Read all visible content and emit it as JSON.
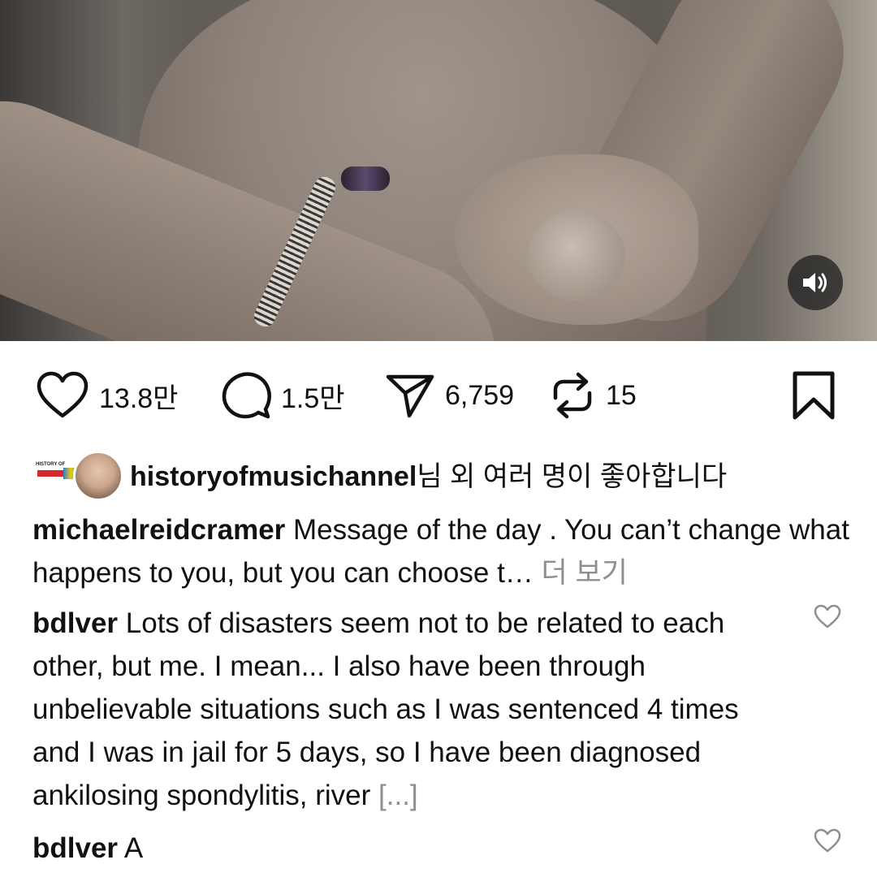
{
  "actions": {
    "likes_count": "13.8만",
    "comments_count": "1.5만",
    "shares_count": "6,759",
    "reposts_count": "15"
  },
  "liked_by": {
    "user": "historyofmusichannel",
    "suffix": "님 외 여러 명이 좋아합니다"
  },
  "caption": {
    "username": "michaelreidcramer",
    "text": "Message of the day . You can’t change what happens to you, but you can choose t…",
    "more_label": "더 보기"
  },
  "comments": [
    {
      "username": "bdlver",
      "text": "Lots of disasters seem not to be related to each other, but me. I mean... I also have been through unbelievable situations such as I was sentenced 4 times and I was in jail for 5 days, so I have been diagnosed ankilosing spondylitis, river",
      "more_label": "[...]"
    },
    {
      "username": "bdlver",
      "text": "A"
    }
  ],
  "icons": {
    "like": "heart-icon",
    "comment": "comment-bubble-icon",
    "share": "paper-plane-icon",
    "repost": "repost-icon",
    "save": "bookmark-icon",
    "sound": "speaker-icon",
    "comment_like": "heart-outline-icon"
  }
}
